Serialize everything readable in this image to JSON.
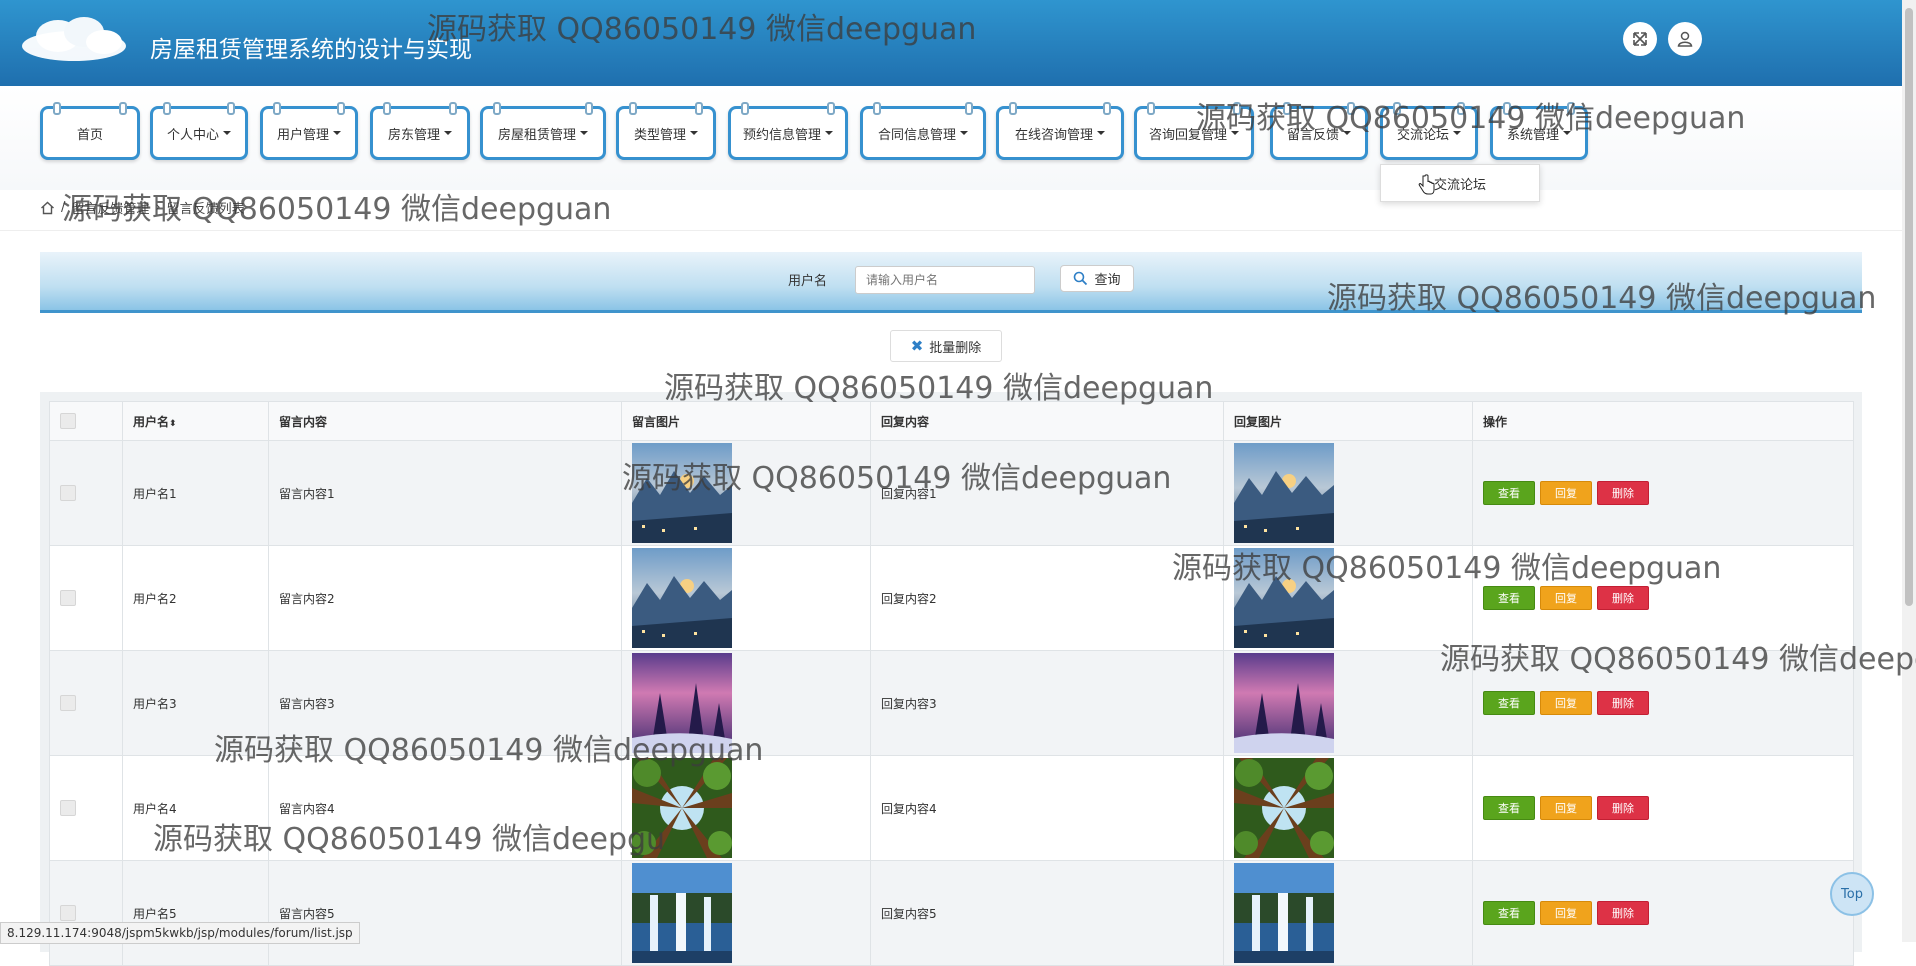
{
  "header": {
    "title": "房屋租赁管理系统的设计与实现"
  },
  "nav": {
    "items": [
      {
        "label": "首页",
        "caret": false
      },
      {
        "label": "个人中心",
        "caret": true
      },
      {
        "label": "用户管理",
        "caret": true
      },
      {
        "label": "房东管理",
        "caret": true
      },
      {
        "label": "房屋租赁管理",
        "caret": true
      },
      {
        "label": "类型管理",
        "caret": true
      },
      {
        "label": "预约信息管理",
        "caret": true
      },
      {
        "label": "合同信息管理",
        "caret": true
      },
      {
        "label": "在线咨询管理",
        "caret": true
      },
      {
        "label": "咨询回复管理",
        "caret": true
      },
      {
        "label": "留言反馈",
        "caret": true
      },
      {
        "label": "交流论坛",
        "caret": true
      },
      {
        "label": "系统管理",
        "caret": true
      }
    ]
  },
  "dropdown": {
    "item": "交流论坛"
  },
  "breadcrumb": {
    "sep": "/",
    "parent": "留言反馈管理",
    "arrow": "›",
    "current": "留言反馈列表"
  },
  "search": {
    "label": "用户名",
    "placeholder": "请输入用户名",
    "button": "查询"
  },
  "batch_delete": "批量删除",
  "table": {
    "columns": [
      "",
      "用户名",
      "留言内容",
      "留言图片",
      "回复内容",
      "回复图片",
      "操作"
    ],
    "rows": [
      {
        "user": "用户名1",
        "content": "留言内容1",
        "reply": "回复内容1",
        "image": "mountain"
      },
      {
        "user": "用户名2",
        "content": "留言内容2",
        "reply": "回复内容2",
        "image": "mountain"
      },
      {
        "user": "用户名3",
        "content": "留言内容3",
        "reply": "回复内容3",
        "image": "snow"
      },
      {
        "user": "用户名4",
        "content": "留言内容4",
        "reply": "回复内容4",
        "image": "forest"
      },
      {
        "user": "用户名5",
        "content": "留言内容5",
        "reply": "回复内容5",
        "image": "waterfall"
      }
    ],
    "actions": {
      "view": "查看",
      "reply": "回复",
      "delete": "删除"
    }
  },
  "status_url": "8.129.11.174:9048/jspm5kwkb/jsp/modules/forum/list.jsp",
  "top_button": "Top",
  "watermarks": [
    "源码获取 QQ86050149 微信deepguan",
    "源码获取 QQ86050149 微信deepguan",
    "源码获取 QQ86050149 微信deepguan",
    "源码获取 QQ86050149 微信deepguan",
    "源码获取 QQ86050149 微信deepguan",
    "源码获取 QQ86050149 微信deepguan",
    "源码获取 QQ86050149 微信deepguan",
    "源码获取 QQ86050149 微信deepg",
    "源码获取 QQ86050149 微信deepguan",
    "源码获取 QQ86050149 微信deepgu"
  ],
  "colors": {
    "header": "#2f95cf",
    "menu_border": "#3691cf",
    "view": "#5aa51d",
    "reply": "#f0a31c",
    "delete": "#dd3246"
  }
}
